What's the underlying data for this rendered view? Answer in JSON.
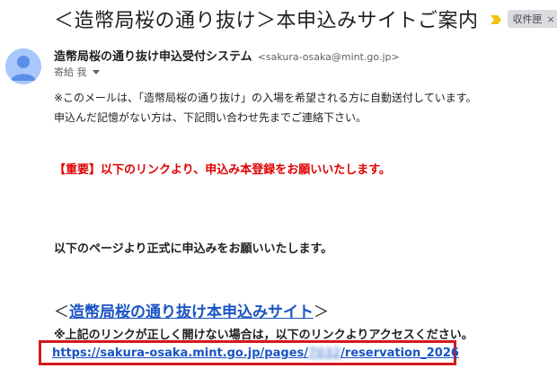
{
  "email": {
    "subject": "＜造幣局桜の通り抜け＞本申込みサイトご案内",
    "label": "収件匣",
    "label_close": "×",
    "importance_icon": "importance-marker-icon",
    "sender": {
      "name": "造幣局桜の通り抜け申込受付システム",
      "email": "<sakura-osaka@mint.go.jp>",
      "recipient": "寄給 我"
    },
    "body": {
      "line1": "※このメールは、「造幣局桜の通り抜け」の入場を希望される方に自動送付しています。",
      "line2": "申込んだ記憶がない方は、下記問い合わせ先までご連絡下さい。",
      "important": "【重要】以下のリンクより、申込み本登録をお願いいたします。",
      "request": "以下のページより正式に申込みをお願いいたします。",
      "site_open": "＜",
      "site_link": "造幣局桜の通り抜け本申込みサイト",
      "site_close": "＞",
      "note": "※上記のリンクが正しく開けない場合は，以下のリンクよりアクセスください。",
      "url_prefix": "https://sakura-osaka.mint.go.jp/pages/",
      "url_blurred": "7032",
      "url_suffix": "/reservation_2026"
    }
  },
  "colors": {
    "important_red": "#e00000",
    "link_blue": "#1a54c4",
    "highlight_box": "#d4181f",
    "importance_yellow": "#f4c20d"
  }
}
